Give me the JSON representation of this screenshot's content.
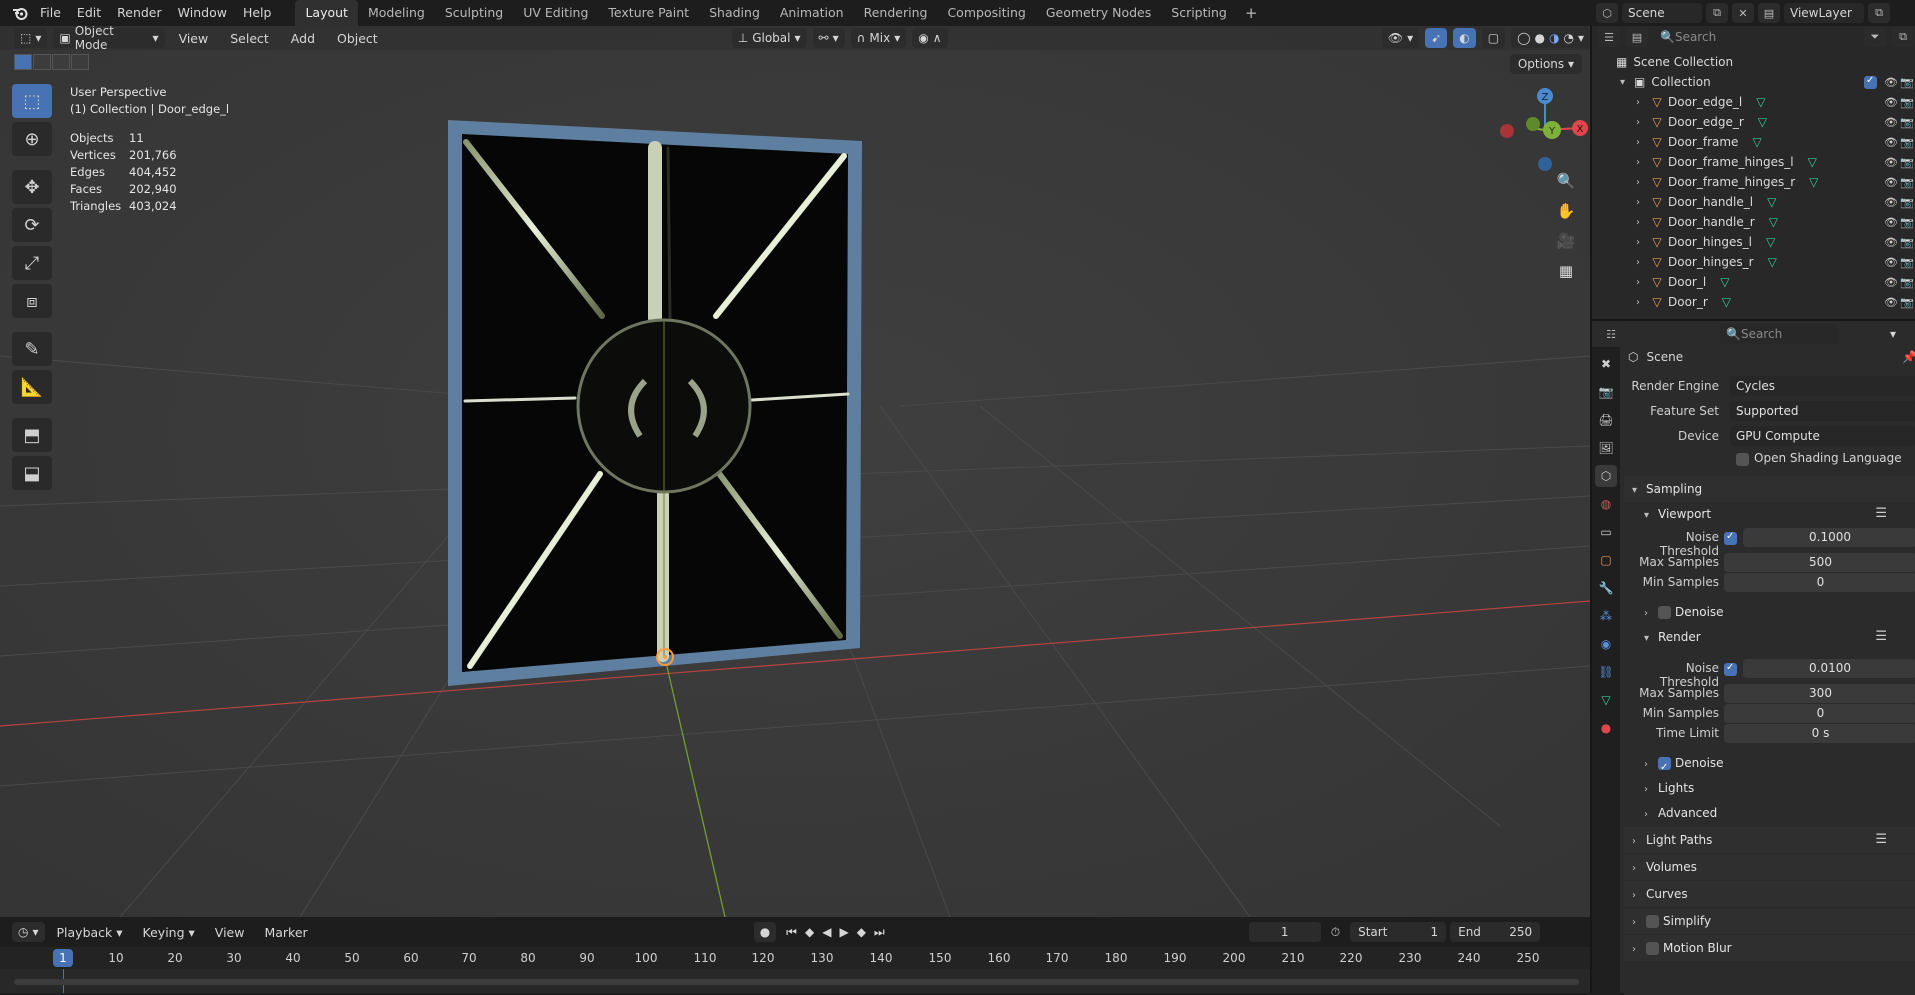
{
  "menu": {
    "items": [
      "File",
      "Edit",
      "Render",
      "Window",
      "Help"
    ]
  },
  "workspaces": {
    "tabs": [
      "Layout",
      "Modeling",
      "Sculpting",
      "UV Editing",
      "Texture Paint",
      "Shading",
      "Animation",
      "Rendering",
      "Compositing",
      "Geometry Nodes",
      "Scripting"
    ],
    "active": "Layout",
    "add": "+"
  },
  "scenebar": {
    "scene": "Scene",
    "viewlayer": "ViewLayer"
  },
  "viewport_header": {
    "mode": "Object Mode",
    "menus": [
      "View",
      "Select",
      "Add",
      "Object"
    ],
    "orientation": "Global",
    "snap_target": "Mix",
    "options": "Options"
  },
  "overlay": {
    "perspective": "User Perspective",
    "collection": "(1) Collection | Door_edge_l"
  },
  "stats": [
    {
      "k": "Objects",
      "v": "11"
    },
    {
      "k": "Vertices",
      "v": "201,766"
    },
    {
      "k": "Edges",
      "v": "404,452"
    },
    {
      "k": "Faces",
      "v": "202,940"
    },
    {
      "k": "Triangles",
      "v": "403,024"
    }
  ],
  "gizmo": {
    "z": "Z",
    "y": "Y",
    "x": "X"
  },
  "timeline": {
    "menus": [
      "Playback",
      "Keying",
      "View",
      "Marker"
    ],
    "current_frame": "1",
    "start_label": "Start",
    "start": "1",
    "end_label": "End",
    "end": "250",
    "ticks": [
      "1",
      "10",
      "20",
      "30",
      "40",
      "50",
      "60",
      "70",
      "80",
      "90",
      "100",
      "110",
      "120",
      "130",
      "140",
      "150",
      "160",
      "170",
      "180",
      "190",
      "200",
      "210",
      "220",
      "230",
      "240",
      "250"
    ]
  },
  "outliner": {
    "search_placeholder": "Search",
    "scene_collection": "Scene Collection",
    "collection": "Collection",
    "objects": [
      "Door_edge_l",
      "Door_edge_r",
      "Door_frame",
      "Door_frame_hinges_l",
      "Door_frame_hinges_r",
      "Door_handle_l",
      "Door_handle_r",
      "Door_hinges_l",
      "Door_hinges_r",
      "Door_l",
      "Door_r"
    ]
  },
  "properties": {
    "search_placeholder": "Search",
    "context": "Scene",
    "render_engine_label": "Render Engine",
    "render_engine": "Cycles",
    "feature_set_label": "Feature Set",
    "feature_set": "Supported",
    "device_label": "Device",
    "device": "GPU Compute",
    "osl_label": "Open Shading Language",
    "sampling": "Sampling",
    "viewport": "Viewport",
    "noise_threshold_label": "Noise Threshold",
    "viewport_noise": "0.1000",
    "max_samples_label": "Max Samples",
    "viewport_max": "500",
    "min_samples_label": "Min Samples",
    "viewport_min": "0",
    "denoise_label": "Denoise",
    "render": "Render",
    "render_noise": "0.0100",
    "render_max": "300",
    "render_min": "0",
    "time_limit_label": "Time Limit",
    "time_limit": "0 s",
    "lights": "Lights",
    "advanced": "Advanced",
    "light_paths": "Light Paths",
    "volumes": "Volumes",
    "curves": "Curves",
    "simplify": "Simplify",
    "motion_blur": "Motion Blur"
  },
  "colors": {
    "accent": "#4772b3",
    "x_axis": "#e0464b",
    "y_axis": "#7fb03a",
    "z_axis": "#4a8ad0",
    "frame": "#5f7fa0"
  }
}
